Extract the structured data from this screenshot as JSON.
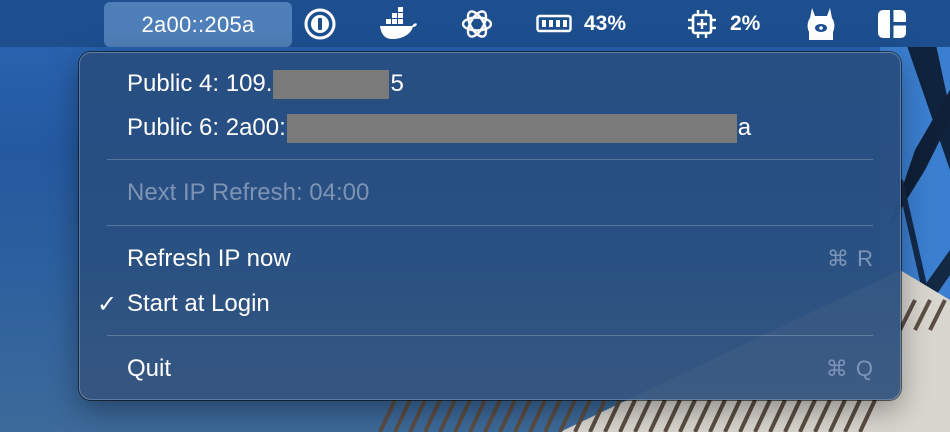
{
  "menubar": {
    "ip_label": "2a00::205a",
    "icons": [
      "onepassword-icon",
      "docker-icon",
      "openai-icon",
      "memory-icon",
      "cpu-icon",
      "ollama-icon",
      "layout-icon"
    ],
    "memory_percent": "43%",
    "cpu_percent": "2%"
  },
  "menu": {
    "public4_prefix": "Public 4: 109.",
    "public4_suffix": "5",
    "public6_prefix": "Public 6: 2a00:",
    "public6_suffix": "a",
    "next_refresh": "Next IP Refresh: 04:00",
    "refresh_now": "Refresh IP now",
    "refresh_shortcut": "⌘ R",
    "start_at_login": "Start at Login",
    "start_at_login_checked": "✓",
    "quit": "Quit",
    "quit_shortcut": "⌘ Q"
  }
}
